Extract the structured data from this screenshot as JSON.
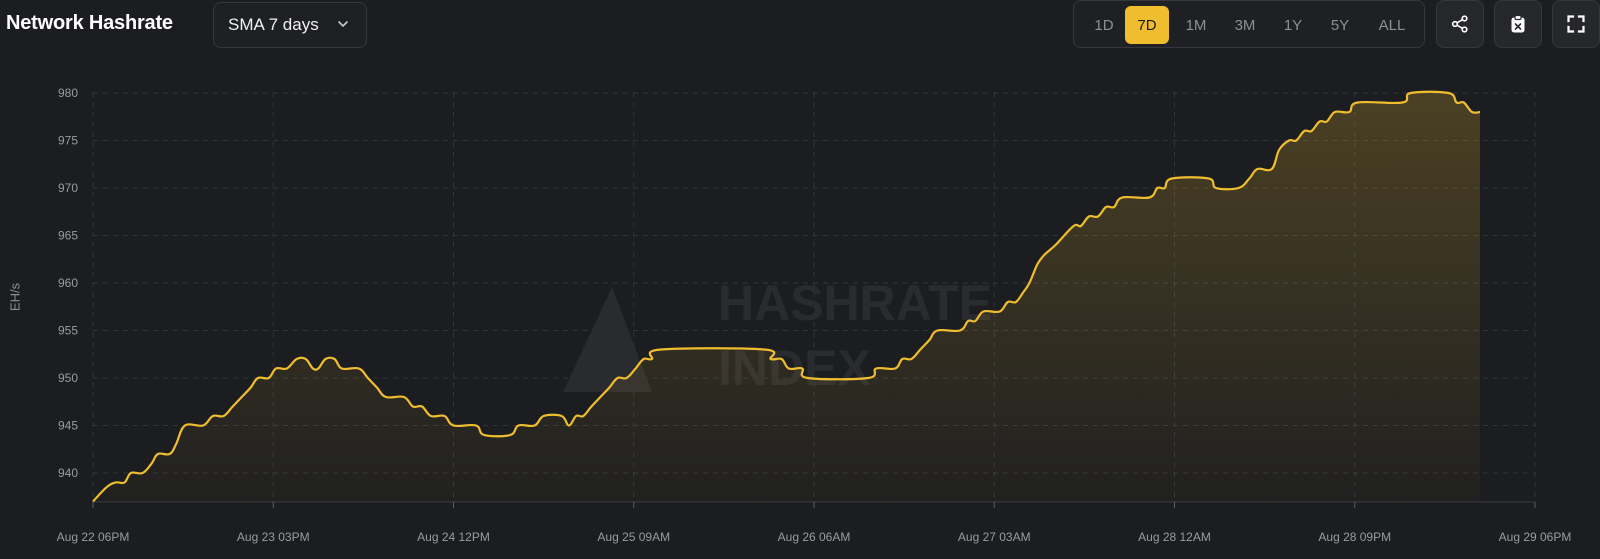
{
  "header": {
    "title": "Network Hashrate",
    "sma_select": "SMA 7 days",
    "ranges": [
      {
        "label": "1D",
        "active": false
      },
      {
        "label": "7D",
        "active": true
      },
      {
        "label": "1M",
        "active": false
      },
      {
        "label": "3M",
        "active": false
      },
      {
        "label": "1Y",
        "active": false
      },
      {
        "label": "5Y",
        "active": false
      },
      {
        "label": "ALL",
        "active": false
      }
    ],
    "icons": [
      "share-icon",
      "clipboard-icon",
      "fullscreen-icon"
    ]
  },
  "watermark": {
    "line1": "HASHRATE",
    "line2": "INDEX"
  },
  "colors": {
    "accent": "#f0bd2e",
    "background": "#1c1d20",
    "grid": "#33353a"
  },
  "chart_data": {
    "type": "area",
    "ylabel": "EH/s",
    "xlabel": "",
    "ylim": [
      937,
      981
    ],
    "yticks": [
      940,
      945,
      950,
      955,
      960,
      965,
      970,
      975,
      980
    ],
    "x_ticks": [
      "Aug 22 06PM",
      "Aug 23 03PM",
      "Aug 24 12PM",
      "Aug 25 09AM",
      "Aug 26 06AM",
      "Aug 27 03AM",
      "Aug 28 12AM",
      "Aug 28 09PM",
      "Aug 29 06PM"
    ],
    "x_unit": "hours since Aug 22 06PM",
    "grid": true,
    "series": [
      {
        "name": "",
        "points": [
          [
            0,
            937
          ],
          [
            1.5,
            938.5
          ],
          [
            2.5,
            939
          ],
          [
            3.5,
            939
          ],
          [
            4.2,
            940
          ],
          [
            5.5,
            940
          ],
          [
            6.5,
            941
          ],
          [
            7.2,
            942
          ],
          [
            8.5,
            942
          ],
          [
            9.2,
            943
          ],
          [
            10.2,
            945
          ],
          [
            12.2,
            945
          ],
          [
            13.3,
            946
          ],
          [
            14.5,
            946
          ],
          [
            15.5,
            947
          ],
          [
            16.5,
            948
          ],
          [
            17.5,
            949
          ],
          [
            18.3,
            950
          ],
          [
            19.5,
            950
          ],
          [
            20.3,
            951
          ],
          [
            21.5,
            951
          ],
          [
            22.6,
            952
          ],
          [
            23.6,
            952
          ],
          [
            24.4,
            951
          ],
          [
            25,
            951
          ],
          [
            25.8,
            952
          ],
          [
            26.8,
            952
          ],
          [
            27.6,
            951
          ],
          [
            29.5,
            951
          ],
          [
            30.5,
            950
          ],
          [
            31.5,
            949
          ],
          [
            32.5,
            948
          ],
          [
            34.5,
            948
          ],
          [
            35.5,
            947
          ],
          [
            36.5,
            947
          ],
          [
            37.5,
            946
          ],
          [
            39,
            946
          ],
          [
            40,
            945
          ],
          [
            42.5,
            945
          ],
          [
            43.4,
            944
          ],
          [
            46.3,
            944
          ],
          [
            47.2,
            945
          ],
          [
            49,
            945
          ],
          [
            50,
            946
          ],
          [
            52,
            946
          ],
          [
            52.8,
            945
          ],
          [
            53.6,
            946
          ],
          [
            54.4,
            946
          ],
          [
            55.3,
            947
          ],
          [
            56.3,
            948
          ],
          [
            57.3,
            949
          ],
          [
            58.2,
            950
          ],
          [
            59.2,
            950
          ],
          [
            60.2,
            951
          ],
          [
            61.1,
            952
          ],
          [
            62,
            952
          ],
          [
            63,
            953
          ],
          [
            74.5,
            953
          ],
          [
            75.2,
            952
          ],
          [
            76.4,
            952
          ],
          [
            77.2,
            951
          ],
          [
            78.7,
            951
          ],
          [
            79.3,
            950
          ],
          [
            86,
            950
          ],
          [
            86.9,
            951
          ],
          [
            89,
            951
          ],
          [
            89.8,
            952
          ],
          [
            90.8,
            952
          ],
          [
            91.8,
            953
          ],
          [
            92.8,
            954
          ],
          [
            93.7,
            955
          ],
          [
            96.2,
            955
          ],
          [
            97.1,
            956
          ],
          [
            97.9,
            956
          ],
          [
            98.8,
            957
          ],
          [
            100.6,
            957
          ],
          [
            101.5,
            958
          ],
          [
            102.4,
            958
          ],
          [
            103.2,
            959
          ],
          [
            103.9,
            960
          ],
          [
            104.8,
            962
          ],
          [
            105.6,
            963
          ],
          [
            106.8,
            964
          ],
          [
            108.8,
            966
          ],
          [
            109.6,
            966
          ],
          [
            110.5,
            967
          ],
          [
            111.5,
            967
          ],
          [
            112.4,
            968
          ],
          [
            113.3,
            968
          ],
          [
            114.2,
            969
          ],
          [
            117.2,
            969
          ],
          [
            118.1,
            970
          ],
          [
            118.9,
            970
          ],
          [
            119.7,
            971
          ],
          [
            123.8,
            971
          ],
          [
            124.6,
            970
          ],
          [
            127.1,
            970
          ],
          [
            128.3,
            971
          ],
          [
            129.2,
            972
          ],
          [
            130.8,
            972
          ],
          [
            131.6,
            974
          ],
          [
            132.7,
            975
          ],
          [
            133.5,
            975
          ],
          [
            134.4,
            976
          ],
          [
            135.2,
            976
          ],
          [
            136.1,
            977
          ],
          [
            136.9,
            977
          ],
          [
            137.8,
            978
          ],
          [
            139.4,
            978
          ],
          [
            140.3,
            979
          ],
          [
            145.3,
            979
          ],
          [
            146.2,
            980
          ],
          [
            150.4,
            980
          ],
          [
            151.3,
            979
          ],
          [
            152.1,
            979
          ],
          [
            153,
            978
          ],
          [
            153.9,
            978
          ]
        ]
      }
    ]
  }
}
